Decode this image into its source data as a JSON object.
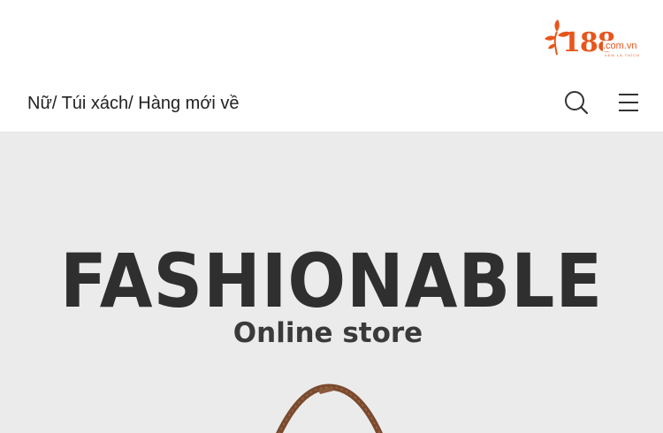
{
  "header": {
    "logo": {
      "number": "188",
      "domain": ".com.vn",
      "slogan": "XEM LÀ THÍCH",
      "brand_color": "#e8551c"
    },
    "breadcrumb": "Nữ/ Túi xách/ Hàng mới về",
    "icons": {
      "search": "search-icon",
      "menu": "menu-icon"
    }
  },
  "hero": {
    "title": "FASHIONABLE",
    "subtitle": "Online store",
    "background": "#ebebeb",
    "text_color": "#2f2f2f",
    "image_subject": "handbag-handle",
    "handle_color": "#7a4a2e"
  }
}
